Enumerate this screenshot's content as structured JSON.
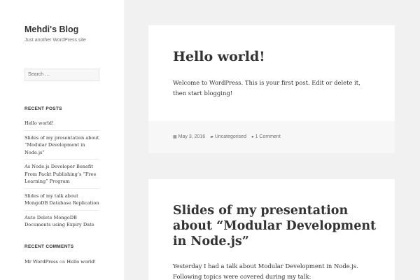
{
  "site": {
    "title": "Mehdi's Blog",
    "description": "Just another WordPress site"
  },
  "search": {
    "placeholder": "Search …"
  },
  "recent_posts": {
    "heading": "RECENT POSTS",
    "items": [
      "Hello world!",
      "Slides of my presentation about “Modular Development in Node.js”",
      "As Node.js Developer Benefit From Packt Publishing’s “Free Learning” Program",
      "Slides of my talk about MongoDB Database Replication",
      "Auto Delete MongoDB Documents using Expiry Date"
    ]
  },
  "recent_comments": {
    "heading": "RECENT COMMENTS",
    "author": "Mr WordPress",
    "on": "on",
    "post": "Hello world!"
  },
  "posts": [
    {
      "title": "Hello world!",
      "body": "Welcome to WordPress. This is your first post. Edit or delete it, then start blogging!",
      "date": "May 3, 2016",
      "category": "Uncategorised",
      "comments": "1 Comment"
    },
    {
      "title": "Slides of my presentation about “Modular Development in Node.js”",
      "body": "Yesterday I had a talk about Modular Development in Node.js. Following topics were covered during my talk:"
    }
  ],
  "icons": {
    "date": "calendar-icon",
    "category": "folder-icon",
    "comments": "comment-icon"
  }
}
